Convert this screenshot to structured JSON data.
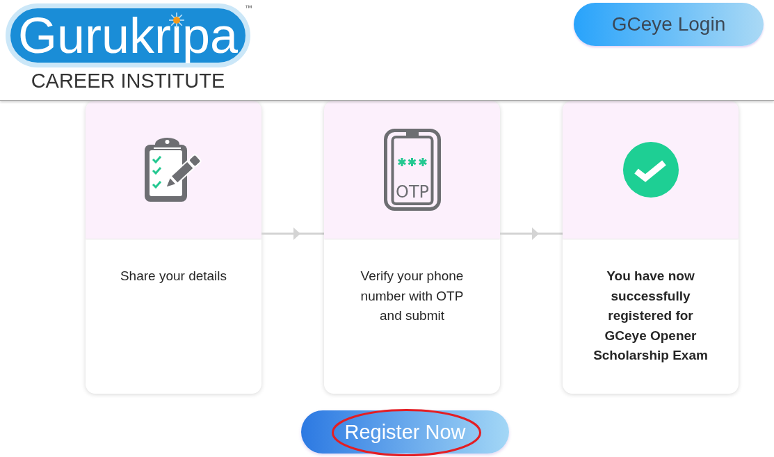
{
  "header": {
    "logo": {
      "wordmark": "Gurukripa",
      "trademark": "™",
      "tagline": "CAREER INSTITUTE"
    },
    "login_button": {
      "label": "GCeye Login"
    }
  },
  "steps": [
    {
      "kind": "clipboard",
      "text": "Share your details",
      "bold": false
    },
    {
      "kind": "otp-phone",
      "icon_label": "OTP",
      "text": "Verify your phone number with OTP and submit",
      "bold": false
    },
    {
      "kind": "check",
      "text": "You have now successfully registered for GCeye Opener Scholarship Exam",
      "bold": true
    }
  ],
  "register_button": {
    "label": "Register Now",
    "highlighted": true
  }
}
